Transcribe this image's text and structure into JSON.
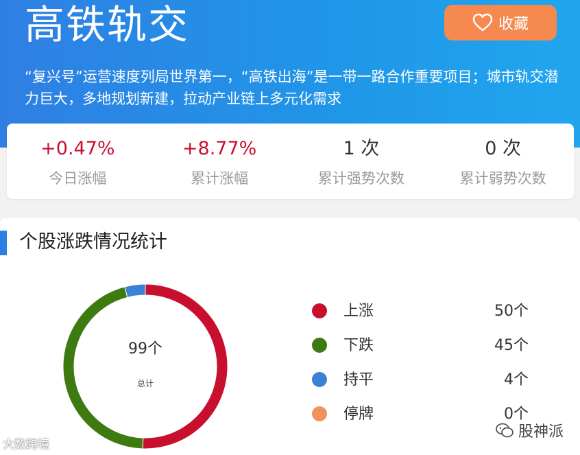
{
  "header": {
    "title": "高铁轨交",
    "favorite_label": "收藏",
    "description": "“复兴号”运营速度列局世界第一，“高铁出海”是一带一路合作重要项目；城市轨交潜力巨大，多地规划新建，拉动产业链上多元化需求"
  },
  "stats": [
    {
      "value": "+0.47%",
      "label": "今日涨幅"
    },
    {
      "value": "+8.77%",
      "label": "累计涨幅"
    },
    {
      "value": "1 次",
      "label": "累计强势次数"
    },
    {
      "value": "0 次",
      "label": "累计弱势次数"
    }
  ],
  "distribution": {
    "title": "个股涨跌情况统计",
    "total_value": "99个",
    "total_label": "总计",
    "items": [
      {
        "label": "上涨",
        "count": "50个",
        "color": "#c8102e"
      },
      {
        "label": "下跌",
        "count": "45个",
        "color": "#3d7a10"
      },
      {
        "label": "持平",
        "count": "4个",
        "color": "#3b82d6"
      },
      {
        "label": "停牌",
        "count": "0个",
        "color": "#f0915e"
      }
    ]
  },
  "chart_data": {
    "type": "pie",
    "categories": [
      "上涨",
      "下跌",
      "持平",
      "停牌"
    ],
    "values": [
      50,
      45,
      4,
      0
    ],
    "colors": [
      "#c8102e",
      "#3d7a10",
      "#3b82d6",
      "#f0915e"
    ],
    "title": "个股涨跌情况统计"
  },
  "watermarks": {
    "left": "大数跨境",
    "right": "股神派"
  }
}
